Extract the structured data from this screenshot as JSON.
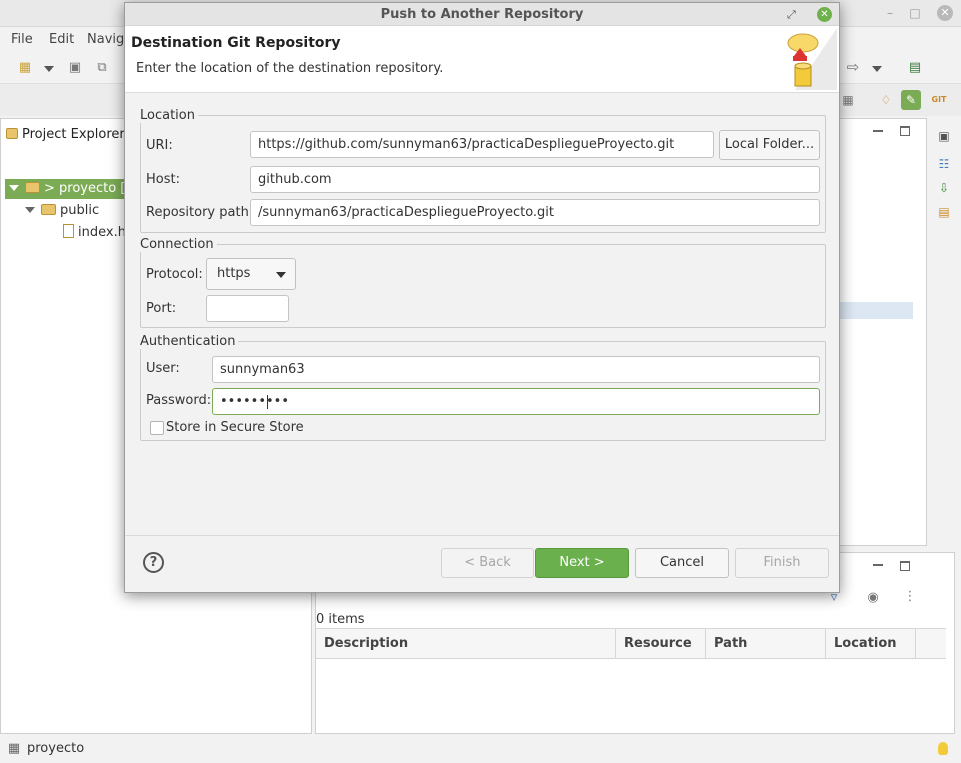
{
  "background": {
    "menu": [
      "File",
      "Edit",
      "Navig"
    ],
    "explorer": {
      "title": "Project Explorer",
      "project_row": "> proyecto [P",
      "folder_row": "public",
      "file_row": "index.h"
    },
    "problems": {
      "count": "0 items",
      "columns": [
        "Description",
        "Resource",
        "Path",
        "Location"
      ]
    },
    "status": "proyecto"
  },
  "dialog": {
    "title": "Push to Another Repository",
    "heading": "Destination Git Repository",
    "description": "Enter the location of the destination repository.",
    "location": {
      "group": "Location",
      "uri_label": "URI:",
      "uri_value": "https://github.com/sunnyman63/practicaDespliegueProyecto.git",
      "local_folder_button": "Local Folder...",
      "host_label": "Host:",
      "host_value": "github.com",
      "repo_path_label": "Repository path:",
      "repo_path_value": "/sunnyman63/practicaDespliegueProyecto.git"
    },
    "connection": {
      "group": "Connection",
      "protocol_label": "Protocol:",
      "protocol_value": "https",
      "port_label": "Port:",
      "port_value": ""
    },
    "authentication": {
      "group": "Authentication",
      "user_label": "User:",
      "user_value": "sunnyman63",
      "password_label": "Password:",
      "password_value": "•••••••••",
      "store_label": "Store in Secure Store"
    },
    "buttons": {
      "help": "?",
      "back": "< Back",
      "next": "Next >",
      "cancel": "Cancel",
      "finish": "Finish"
    }
  },
  "colors": {
    "accent_green": "#6ab04c",
    "selection_green": "#7cab55"
  }
}
